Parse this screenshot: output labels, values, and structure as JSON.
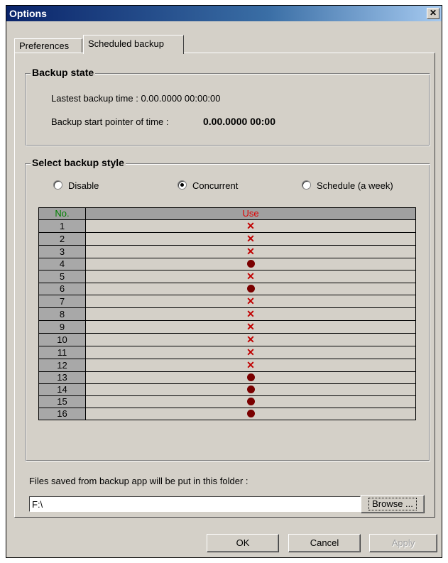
{
  "window": {
    "title": "Options",
    "close_glyph": "✕"
  },
  "tabs": [
    {
      "label": "Preferences",
      "active": false
    },
    {
      "label": "Scheduled backup",
      "active": true
    }
  ],
  "backup_state": {
    "title": "Backup state",
    "latest_time_label": "Lastest backup time : 0.00.0000 00:00:00",
    "start_pointer_label": "Backup start pointer of time :",
    "start_pointer_value": "0.00.0000 00:00"
  },
  "backup_style": {
    "title": "Select backup style",
    "options": [
      {
        "label": "Disable",
        "checked": false
      },
      {
        "label": "Concurrent",
        "checked": true
      },
      {
        "label": "Schedule (a week)",
        "checked": false
      }
    ],
    "table": {
      "headers": {
        "no": "No.",
        "use": "Use"
      },
      "rows": [
        {
          "no": "1",
          "use": "x"
        },
        {
          "no": "2",
          "use": "x"
        },
        {
          "no": "3",
          "use": "x"
        },
        {
          "no": "4",
          "use": "dot"
        },
        {
          "no": "5",
          "use": "x"
        },
        {
          "no": "6",
          "use": "dot"
        },
        {
          "no": "7",
          "use": "x"
        },
        {
          "no": "8",
          "use": "x"
        },
        {
          "no": "9",
          "use": "x"
        },
        {
          "no": "10",
          "use": "x"
        },
        {
          "no": "11",
          "use": "x"
        },
        {
          "no": "12",
          "use": "x"
        },
        {
          "no": "13",
          "use": "dot"
        },
        {
          "no": "14",
          "use": "dot"
        },
        {
          "no": "15",
          "use": "dot"
        },
        {
          "no": "16",
          "use": "dot"
        }
      ],
      "x_glyph": "✕"
    }
  },
  "folder": {
    "label": "Files saved from backup app will be put in this folder :",
    "value": "F:\\",
    "browse_label": "Browse ..."
  },
  "buttons": {
    "ok": "OK",
    "cancel": "Cancel",
    "apply": "Apply"
  },
  "colors": {
    "titlebar_start": "#0a246a",
    "dialog_face": "#d4d0c8",
    "x_mark": "#c00000",
    "dot_mark": "#7a0000"
  }
}
